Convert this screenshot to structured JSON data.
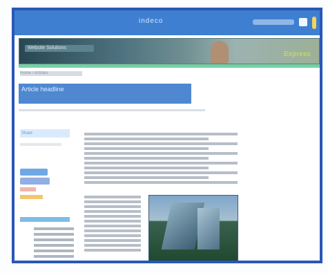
{
  "app": {
    "brand": "indeco"
  },
  "search": {
    "placeholder": ""
  },
  "banner": {
    "label": "Website Solutions",
    "logo": "Express"
  },
  "breadcrumb": "Home / Articles",
  "article": {
    "headline": "Article headline"
  },
  "sidebar": {
    "title": "Share"
  },
  "icons": {
    "user": "user-icon",
    "chevron": "chevron-icon"
  },
  "colors": {
    "primary": "#3e7fd1",
    "accent": "#75d0a2",
    "frame": "#2a57b6"
  }
}
